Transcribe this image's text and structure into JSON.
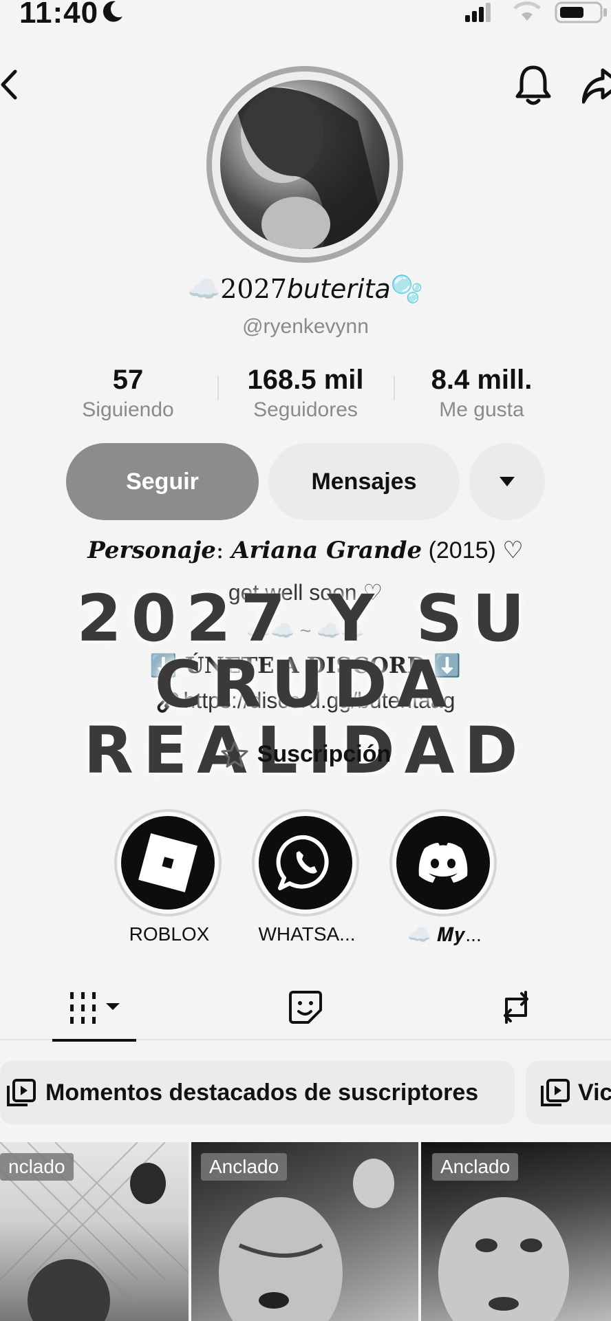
{
  "status_bar": {
    "time": "11:40"
  },
  "profile": {
    "display_name": "☁️2027𝘣𝘶𝘵𝘦𝘳𝘪𝘵𝘢🫧",
    "handle": "@ryenkevynn"
  },
  "stats": [
    {
      "value": "57",
      "label": "Siguiendo"
    },
    {
      "value": "168.5 mil",
      "label": "Seguidores"
    },
    {
      "value": "8.4 mill.",
      "label": "Me gusta"
    }
  ],
  "buttons": {
    "follow": "Seguir",
    "messages": "Mensajes"
  },
  "bio": {
    "line1_label": "Personaje",
    "line1_sep": ": ",
    "line1_name": "Ariana Grande",
    "line1_rest": " (2015) ♡",
    "line2": "get well soon ♡",
    "line3": "☁️☁️ ~ ☁️☁️",
    "line4": "⬇️ ÚNETE A DISCORD ⬇️",
    "link": "https://discord.gg/buteritaag"
  },
  "overlay_text": {
    "line1": "2027 Y SU CRUDA",
    "line2": "REALIDAD"
  },
  "subscription": "Suscripción",
  "highlights": [
    {
      "caption": "ROBLOX",
      "icon": "roblox-icon"
    },
    {
      "caption": "WHATSA...",
      "icon": "whatsapp-icon"
    },
    {
      "caption": "☁️ 𝑴𝒚...",
      "icon": "discord-icon"
    }
  ],
  "tabs": [
    {
      "icon": "grid-icon"
    },
    {
      "icon": "sticker-icon"
    },
    {
      "icon": "repost-icon"
    }
  ],
  "pills": [
    "Momentos destacados de suscriptores",
    "Vic"
  ],
  "videos": [
    {
      "badge": "nclado"
    },
    {
      "badge": "Anclado"
    },
    {
      "badge": "Anclado"
    }
  ]
}
